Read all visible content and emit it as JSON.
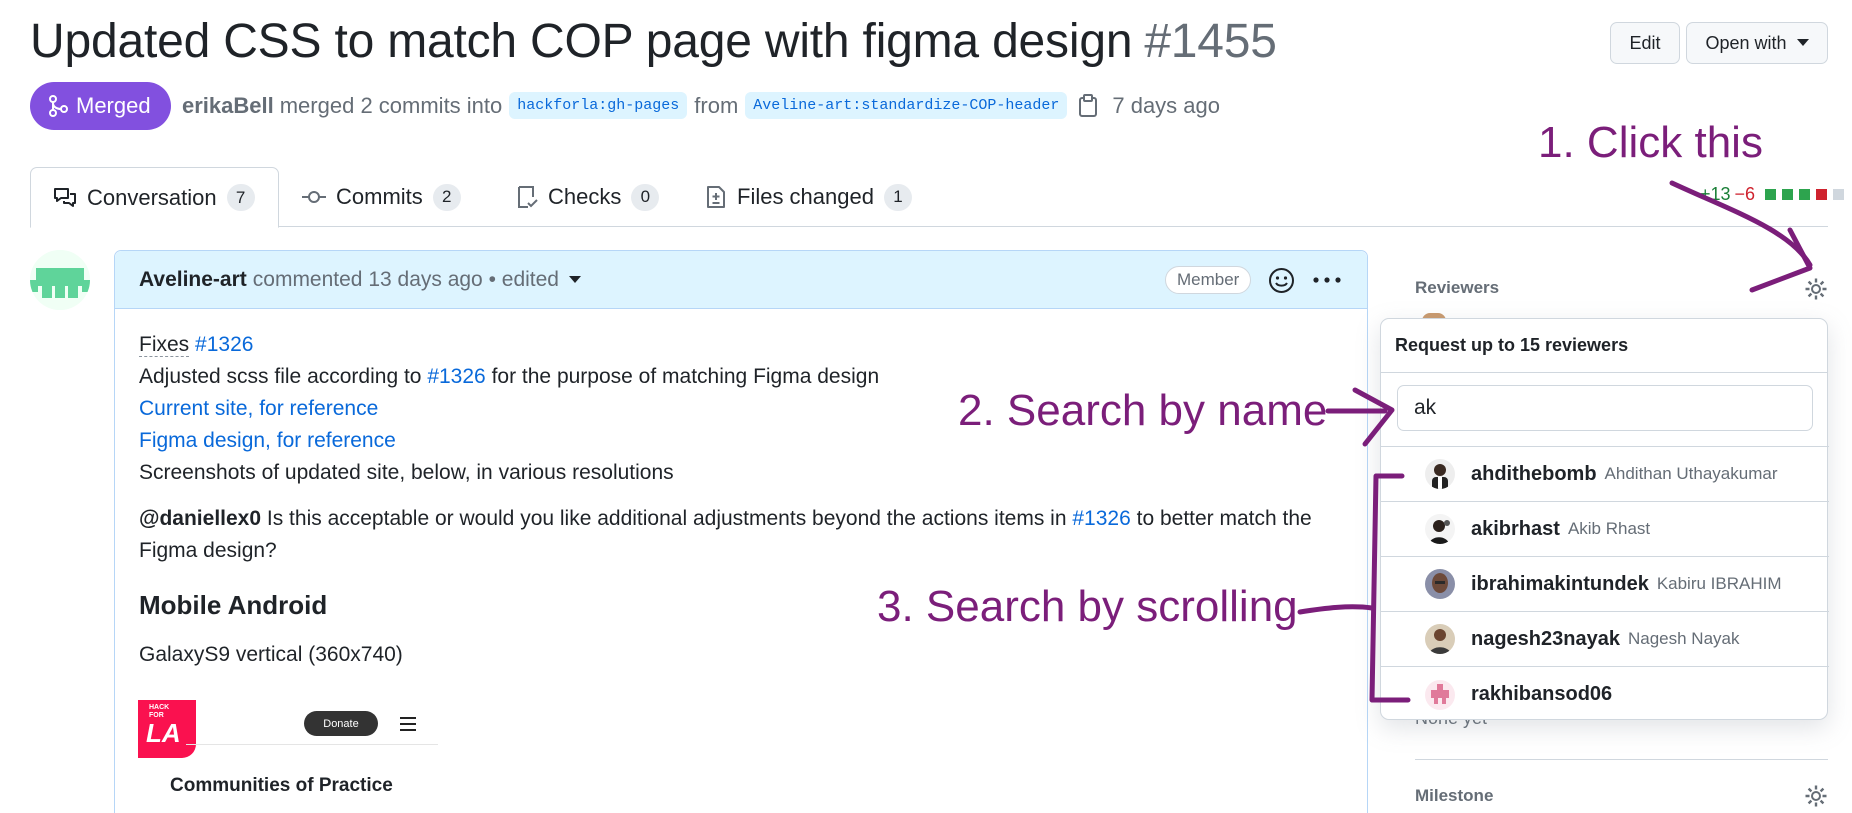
{
  "pr": {
    "title": "Updated CSS to match COP page with figma design",
    "number": "#1455",
    "state": "Merged",
    "author": "erikaBell",
    "merged_text": "merged 2 commits into",
    "base_branch": "hackforla:gh-pages",
    "from_text": "from",
    "head_branch": "Aveline-art:standardize-COP-header",
    "time": "7 days ago"
  },
  "header_buttons": {
    "edit": "Edit",
    "open_with": "Open with"
  },
  "tabs": [
    {
      "label": "Conversation",
      "count": "7"
    },
    {
      "label": "Commits",
      "count": "2"
    },
    {
      "label": "Checks",
      "count": "0"
    },
    {
      "label": "Files changed",
      "count": "1"
    }
  ],
  "diffstat": {
    "add": "+13",
    "del": "−6"
  },
  "comment": {
    "author": "Aveline-art",
    "action": "commented 13 days ago • edited",
    "role": "Member",
    "fixes_label": "Fixes",
    "fixes_link": "#1326",
    "line2_pre": "Adjusted scss file according to",
    "line2_link": "#1326",
    "line2_post": "for the purpose of matching Figma design",
    "link_current": "Current site, for reference",
    "link_figma": "Figma design, for reference",
    "line5": "Screenshots of updated site, below, in various resolutions",
    "mention": "@daniellex0",
    "para_pre": "Is this acceptable or would you like additional adjustments beyond the actions items in",
    "para_link": "#1326",
    "para_post": "to better match the Figma design?",
    "heading": "Mobile Android",
    "device": "GalaxyS9 vertical (360x740)",
    "mock_logo_small": "HACK FOR",
    "mock_logo_big": "LA",
    "mock_donate": "Donate",
    "mock_heading": "Communities of Practice"
  },
  "sidebar": {
    "reviewers": "Reviewers",
    "none_yet": "None yet",
    "milestone": "Milestone"
  },
  "popup": {
    "header": "Request up to 15 reviewers",
    "search_value": "ak",
    "results": [
      {
        "login": "ahdithebomb",
        "name": "Ahdithan Uthayakumar"
      },
      {
        "login": "akibrhast",
        "name": "Akib Rhast"
      },
      {
        "login": "ibrahimakintundek",
        "name": "Kabiru IBRAHIM"
      },
      {
        "login": "nagesh23nayak",
        "name": "Nagesh Nayak"
      },
      {
        "login": "rakhibansod06",
        "name": ""
      }
    ]
  },
  "annotations": {
    "step1": "1. Click this",
    "step2": "2. Search by name",
    "step3": "3. Search by scrolling"
  },
  "colors": {
    "merged": "#8250df",
    "link": "#0969da",
    "annotation": "#7b1e7a"
  }
}
